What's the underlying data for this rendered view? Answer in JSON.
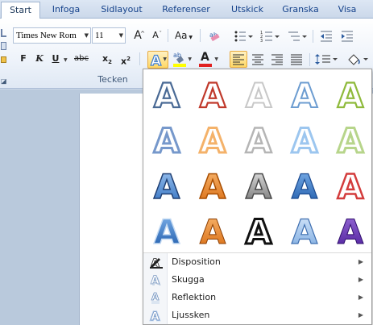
{
  "tabs": [
    {
      "label": "Start",
      "active": true
    },
    {
      "label": "Infoga"
    },
    {
      "label": "Sidlayout"
    },
    {
      "label": "Referenser"
    },
    {
      "label": "Utskick"
    },
    {
      "label": "Granska"
    },
    {
      "label": "Visa"
    }
  ],
  "font": {
    "name": "Times New Rom",
    "size": "11",
    "grow_label": "A",
    "shrink_label": "A",
    "change_case_label": "Aa",
    "clear_format_label": "ab"
  },
  "format": {
    "bold": "F",
    "italic": "K",
    "underline": "U",
    "strike": "abc",
    "subscript": "x",
    "subscript_mark": "2",
    "superscript": "x",
    "superscript_mark": "2",
    "text_effect": "A",
    "highlight_ab": "ab",
    "font_color": "A"
  },
  "group_label": "Tecken",
  "colors": {
    "accent_highlight": "#ffd865",
    "font_color_bar": "#e02020",
    "highlight_bar": "#ffff00"
  },
  "menu_items": [
    {
      "label": "Disposition",
      "icon": "pencil-outline-icon"
    },
    {
      "label": "Skugga",
      "icon": "shadow-a-icon"
    },
    {
      "label": "Reflektion",
      "icon": "reflection-a-icon"
    },
    {
      "label": "Ljussken",
      "icon": "glow-a-icon"
    }
  ],
  "gallery_letter": "A"
}
